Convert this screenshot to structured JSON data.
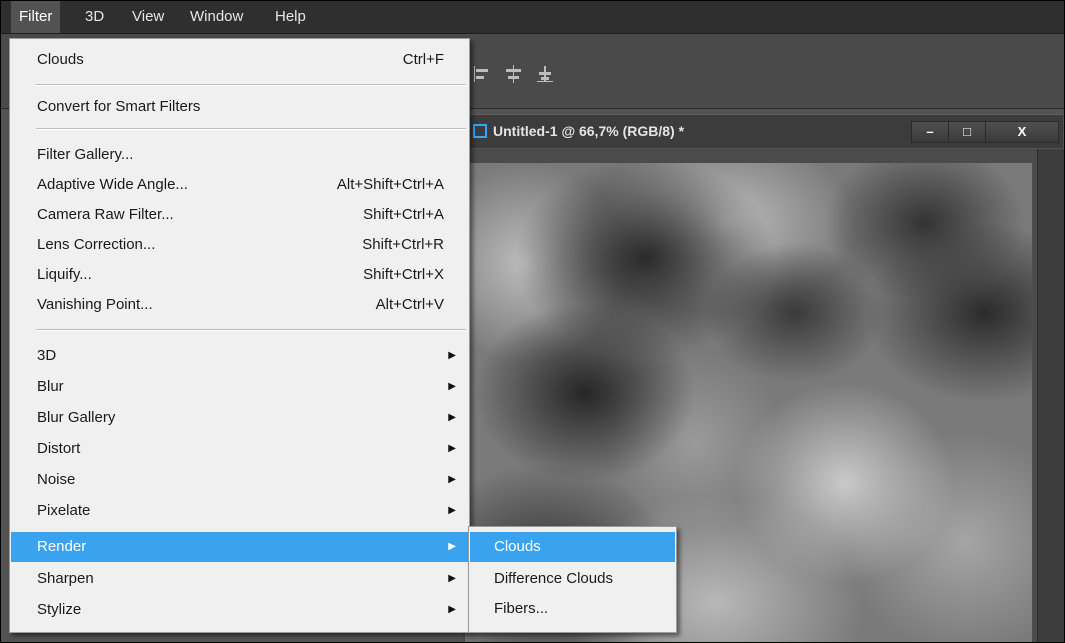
{
  "menubar": {
    "items": [
      {
        "label": "Filter",
        "active": true
      },
      {
        "label": "3D"
      },
      {
        "label": "View"
      },
      {
        "label": "Window"
      },
      {
        "label": "Help"
      }
    ]
  },
  "document": {
    "title": "Untitled-1 @ 66,7% (RGB/8) *",
    "controls": {
      "minimize": "–",
      "restore": "□",
      "close": "X"
    }
  },
  "filter_menu": {
    "last_filter": {
      "label": "Clouds",
      "shortcut": "Ctrl+F"
    },
    "smart": {
      "label": "Convert for Smart Filters"
    },
    "group1": [
      {
        "label": "Filter Gallery...",
        "shortcut": ""
      },
      {
        "label": "Adaptive Wide Angle...",
        "shortcut": "Alt+Shift+Ctrl+A"
      },
      {
        "label": "Camera Raw Filter...",
        "shortcut": "Shift+Ctrl+A"
      },
      {
        "label": "Lens Correction...",
        "shortcut": "Shift+Ctrl+R"
      },
      {
        "label": "Liquify...",
        "shortcut": "Shift+Ctrl+X"
      },
      {
        "label": "Vanishing Point...",
        "shortcut": "Alt+Ctrl+V"
      }
    ],
    "submenus": [
      {
        "label": "3D"
      },
      {
        "label": "Blur"
      },
      {
        "label": "Blur Gallery"
      },
      {
        "label": "Distort"
      },
      {
        "label": "Noise"
      },
      {
        "label": "Pixelate"
      },
      {
        "label": "Render",
        "highlighted": true
      },
      {
        "label": "Sharpen"
      },
      {
        "label": "Stylize"
      }
    ],
    "arrow_glyph": "▶"
  },
  "render_submenu": {
    "items": [
      {
        "label": "Clouds",
        "highlighted": true
      },
      {
        "label": "Difference Clouds"
      },
      {
        "label": "Fibers..."
      }
    ]
  },
  "colors": {
    "highlight": "#3aa3f0",
    "menubar": "#2f2f2f",
    "menu_bg": "#f0f0f0"
  }
}
